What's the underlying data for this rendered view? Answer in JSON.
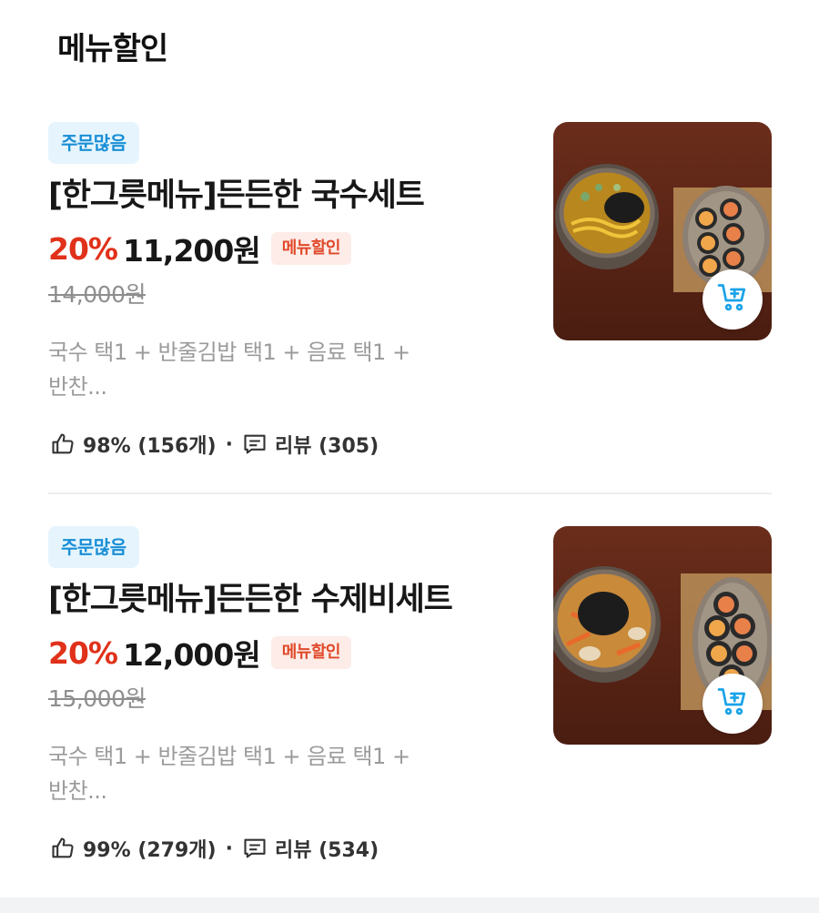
{
  "section": {
    "title": "메뉴할인"
  },
  "items": [
    {
      "badge": "주문많음",
      "name": "[한그릇메뉴]든든한 국수세트",
      "discount": "20%",
      "price": "11,200원",
      "tag": "메뉴할인",
      "original_price": "14,000원",
      "desc_line1": "국수 택1 + 반줄김밥 택1 + 음료 택1 +",
      "desc_line2": "반찬...",
      "likes": "98% (156개)",
      "separator": "·",
      "reviews": "리뷰 (305)",
      "image_icon": "noodle-kimbap-photo",
      "cart_icon": "add-to-cart-icon"
    },
    {
      "badge": "주문많음",
      "name": "[한그릇메뉴]든든한 수제비세트",
      "discount": "20%",
      "price": "12,000원",
      "tag": "메뉴할인",
      "original_price": "15,000원",
      "desc_line1": "국수 택1 + 반줄김밥 택1 + 음료 택1 +",
      "desc_line2": "반찬...",
      "likes": "99% (279개)",
      "separator": "·",
      "reviews": "리뷰 (534)",
      "image_icon": "sujebi-kimbap-photo",
      "cart_icon": "add-to-cart-icon"
    }
  ],
  "colors": {
    "badge_bg": "#e6f5fd",
    "badge_text": "#1a8fd6",
    "discount": "#e0311a",
    "tag_bg": "#fdece8",
    "tag_text": "#e0492a",
    "cart_icon": "#1aa3e8"
  }
}
